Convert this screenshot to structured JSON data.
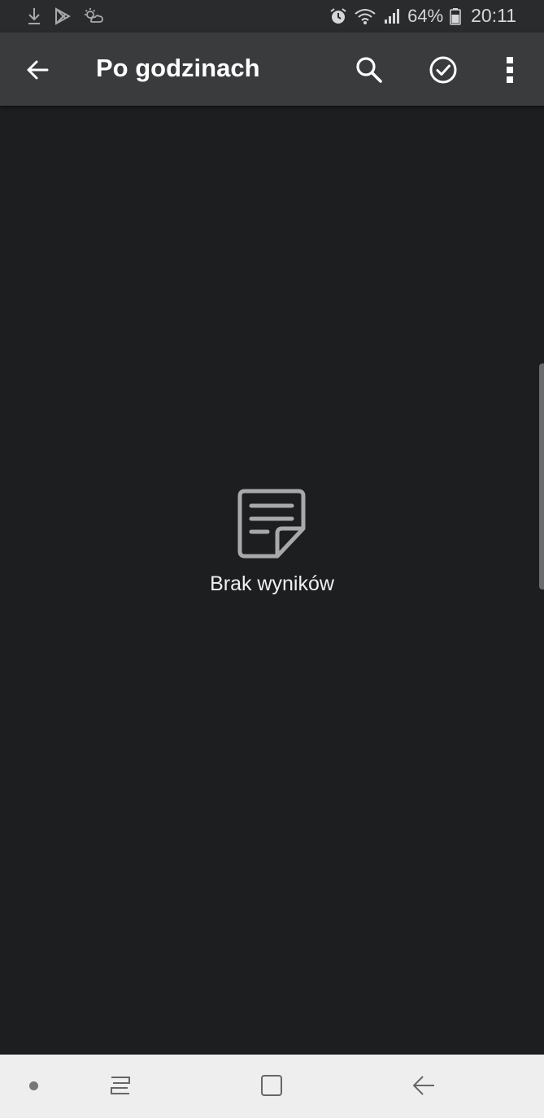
{
  "status_bar": {
    "battery_percent": "64%",
    "time": "20:11",
    "icons": [
      "download-icon",
      "play-store-icon",
      "weather-icon",
      "alarm-icon",
      "wifi-icon",
      "signal-icon",
      "battery-icon"
    ]
  },
  "app_bar": {
    "title": "Po godzinach",
    "icons": [
      "back-arrow-icon",
      "search-icon",
      "check-circle-icon",
      "more-vert-icon"
    ]
  },
  "empty_state": {
    "icon": "note-icon",
    "message": "Brak wyników"
  },
  "nav_bar": {
    "icons": [
      "dot-icon",
      "recents-icon",
      "home-icon",
      "back-icon"
    ]
  },
  "colors": {
    "background": "#1d1e20",
    "app_bar": "#3a3b3d",
    "status_bar": "#2a2b2d",
    "nav_bar": "#eeeeee",
    "text": "#ffffff",
    "icon_gray": "#a9a9a9"
  }
}
